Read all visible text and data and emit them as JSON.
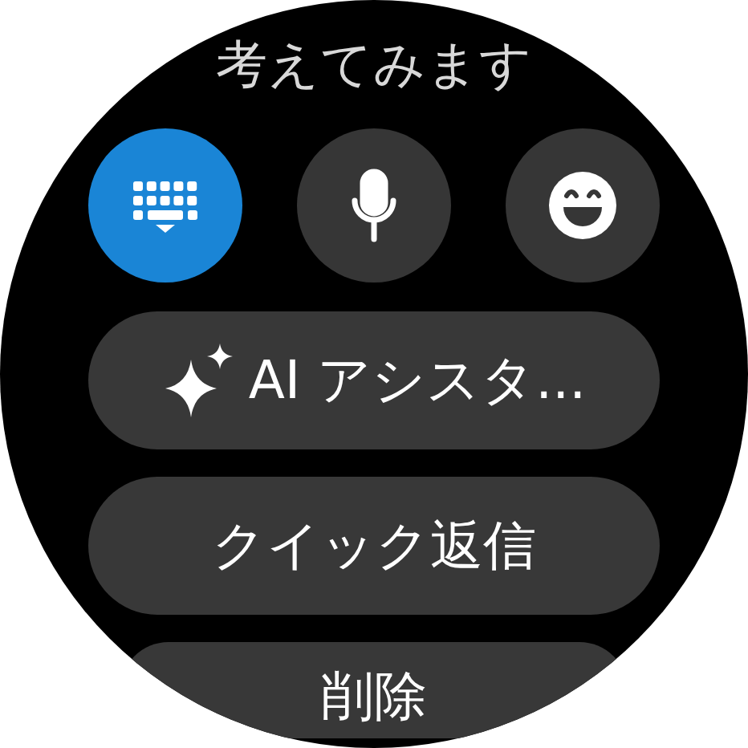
{
  "prompt_text": "考えてみます",
  "input_modes": [
    {
      "kind": "keyboard",
      "selected": true
    },
    {
      "kind": "voice",
      "selected": false
    },
    {
      "kind": "emoji",
      "selected": false
    }
  ],
  "actions": [
    {
      "kind": "ai",
      "label": "AI アシスタ..."
    },
    {
      "kind": "plain",
      "label": "クイック返信"
    },
    {
      "kind": "plain",
      "label": "削除"
    }
  ]
}
